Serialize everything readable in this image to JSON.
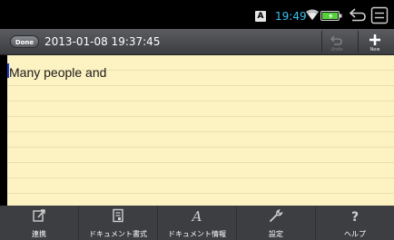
{
  "status_bar": {
    "input_indicator": "A",
    "time": "19:49",
    "wifi_icon": "wifi-icon",
    "battery_icon": "battery-icon"
  },
  "title_bar": {
    "done_label": "Done",
    "document_title": "2013-01-08 19:37:45",
    "undo_label": "Undo",
    "new_label": "New"
  },
  "note": {
    "text": "Many people and"
  },
  "toolbar": {
    "items": [
      {
        "label": "連携",
        "icon": "share-icon"
      },
      {
        "label": "ドキュメント書式",
        "icon": "document-format-icon"
      },
      {
        "label": "ドキュメント情報",
        "icon": "document-info-icon"
      },
      {
        "label": "設定",
        "icon": "wrench-icon"
      },
      {
        "label": "ヘルプ",
        "icon": "help-icon"
      }
    ]
  },
  "colors": {
    "note_background": "#fdf2c1",
    "time_text": "#39c2ee",
    "toolbar_background": "#3d3e41"
  }
}
